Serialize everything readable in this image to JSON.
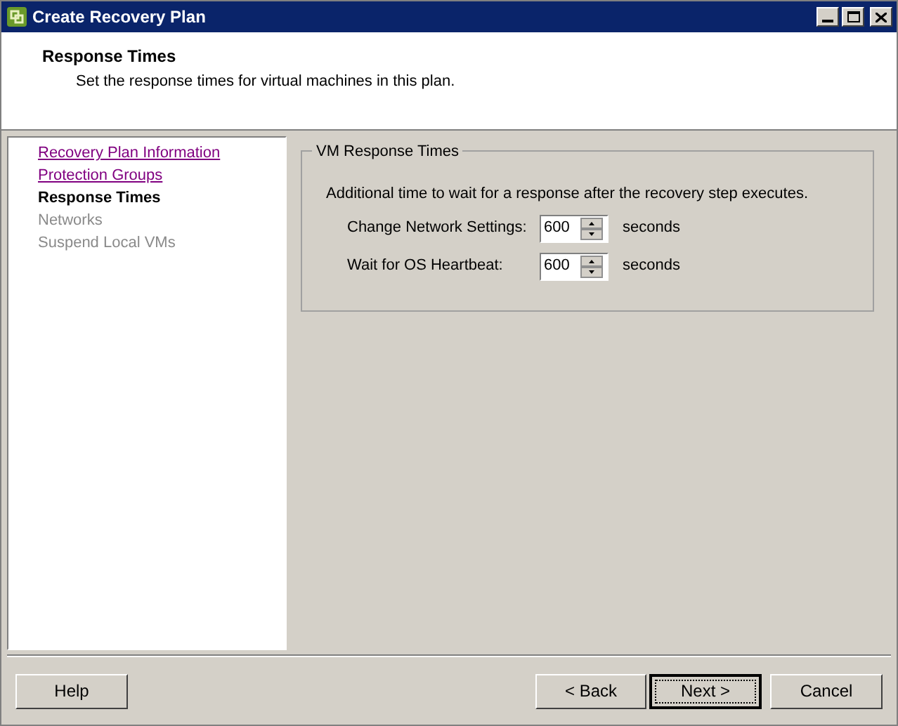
{
  "window": {
    "title": "Create Recovery Plan"
  },
  "header": {
    "title": "Response Times",
    "subtitle": "Set the response times for virtual machines in this plan."
  },
  "steps": [
    {
      "label": "Recovery Plan Information",
      "kind": "visited"
    },
    {
      "label": "Protection Groups",
      "kind": "visited"
    },
    {
      "label": "Response Times",
      "kind": "current"
    },
    {
      "label": "Networks",
      "kind": "disabled"
    },
    {
      "label": "Suspend Local VMs",
      "kind": "disabled"
    }
  ],
  "group": {
    "title": "VM Response Times",
    "description": "Additional time to wait for a response after the recovery step executes.",
    "fields": [
      {
        "label": "Change Network Settings:",
        "value": "600",
        "unit": "seconds"
      },
      {
        "label": "Wait for OS Heartbeat:",
        "value": "600",
        "unit": "seconds"
      }
    ]
  },
  "buttons": {
    "help": "Help",
    "back": "< Back",
    "next": "Next >",
    "cancel": "Cancel"
  }
}
